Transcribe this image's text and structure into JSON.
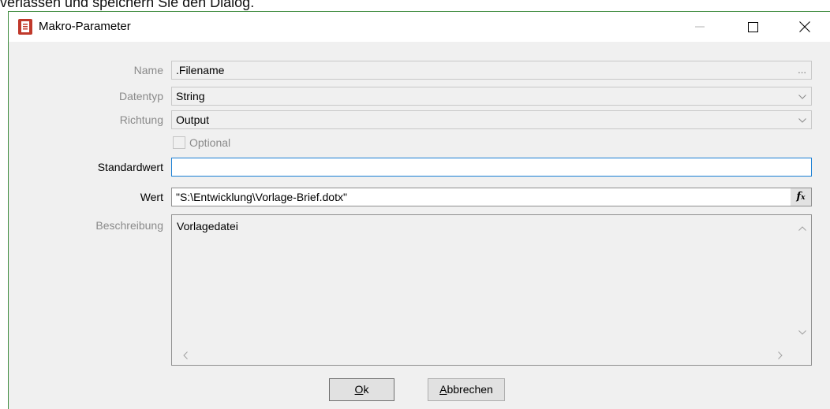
{
  "caption_fragment": "verlassen und speichern Sie den Dialog.",
  "window": {
    "title": "Makro-Parameter",
    "icon": "macro-document-icon",
    "controls": {
      "minimize": "minimize-icon",
      "maximize": "maximize-icon",
      "close": "close-icon"
    }
  },
  "form": {
    "name": {
      "label": "Name",
      "value": ".Filename",
      "button": "..."
    },
    "datentyp": {
      "label": "Datentyp",
      "value": "String"
    },
    "richtung": {
      "label": "Richtung",
      "value": "Output"
    },
    "optional": {
      "label": "Optional",
      "checked": false
    },
    "standardwert": {
      "label": "Standardwert",
      "value": ""
    },
    "wert": {
      "label": "Wert",
      "value": "\"S:\\Entwicklung\\Vorlage-Brief.dotx\"",
      "fx_icon": "function-fx-icon"
    },
    "beschreibung": {
      "label": "Beschreibung",
      "value": "Vorlagedatei"
    }
  },
  "buttons": {
    "ok": {
      "mnemonic": "O",
      "rest": "k"
    },
    "cancel": {
      "mnemonic": "A",
      "rest": "bbrechen"
    }
  }
}
